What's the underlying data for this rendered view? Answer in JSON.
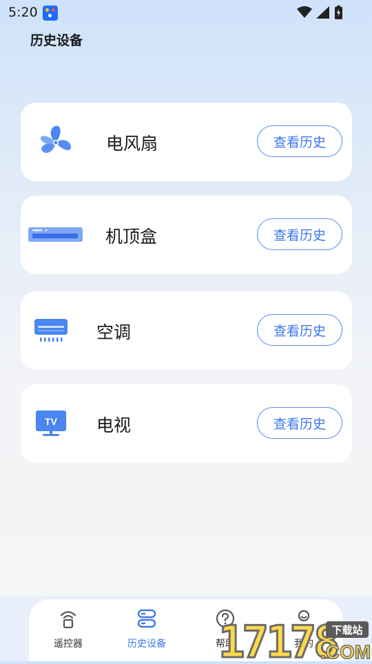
{
  "status_bar": {
    "time": "5:20"
  },
  "page_title": "历史设备",
  "devices": [
    {
      "name": "电风扇",
      "icon": "fan-icon",
      "button_label": "查看历史"
    },
    {
      "name": "机顶盒",
      "icon": "set-top-box-icon",
      "button_label": "查看历史"
    },
    {
      "name": "空调",
      "icon": "air-conditioner-icon",
      "button_label": "查看历史"
    },
    {
      "name": "电视",
      "icon": "tv-icon",
      "button_label": "查看历史",
      "icon_text": "TV"
    }
  ],
  "bottom_nav": [
    {
      "label": "遥控器",
      "icon": "remote-signal-icon",
      "active": false
    },
    {
      "label": "历史设备",
      "icon": "history-devices-icon",
      "active": true
    },
    {
      "label": "帮助",
      "icon": "help-icon",
      "active": false
    },
    {
      "label": "我的",
      "icon": "profile-icon",
      "active": false
    }
  ],
  "watermark": {
    "digits": "17178",
    "domain": ".COM",
    "tag": "下载站"
  },
  "colors": {
    "accent": "#3c78ec",
    "icon_blue": "#4a85f0"
  }
}
